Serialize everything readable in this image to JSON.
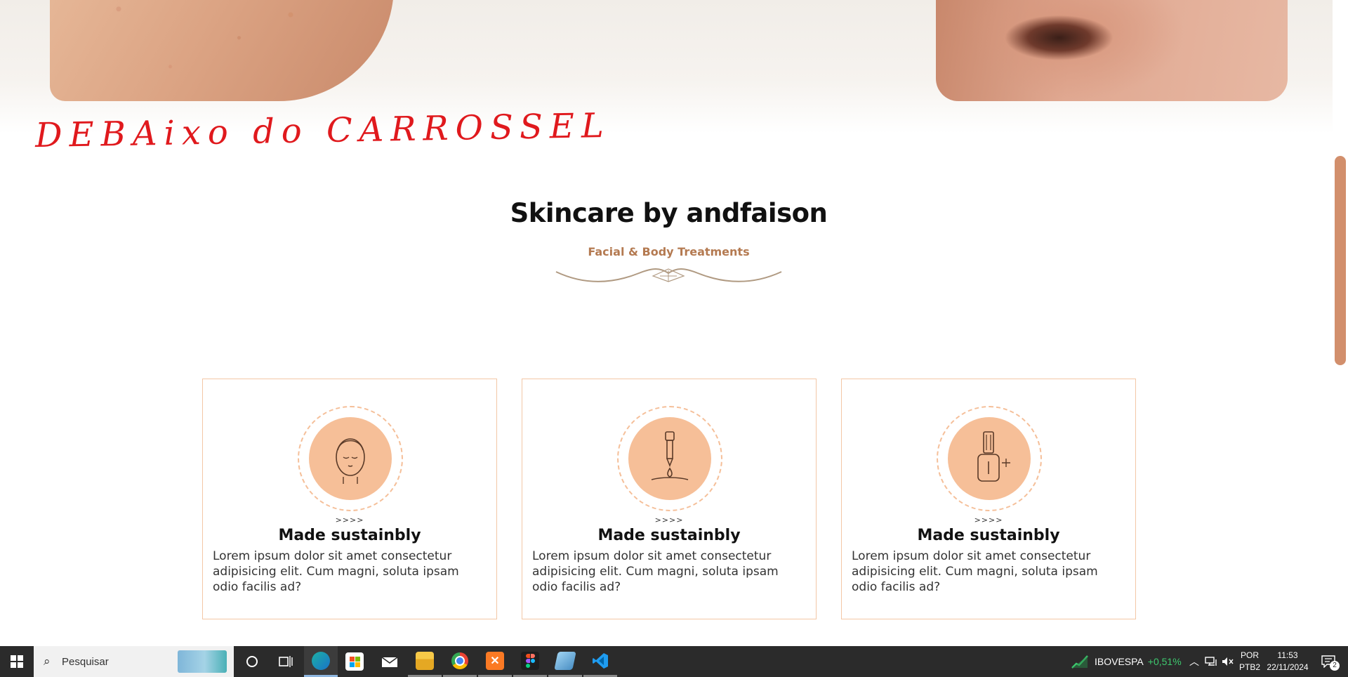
{
  "annotation": {
    "note": "DEBAixo do CARROSSEL"
  },
  "section": {
    "title": "Skincare by andfaison",
    "subtitle": "Facial & Body Treatments"
  },
  "cards": [
    {
      "icon": "face-icon",
      "arrows": ">>>>",
      "title": "Made sustainbly",
      "text": "Lorem ipsum dolor sit amet consectetur adipisicing elit. Cum magni, soluta ipsam odio facilis ad?"
    },
    {
      "icon": "dropper-icon",
      "arrows": ">>>>",
      "title": "Made sustainbly",
      "text": "Lorem ipsum dolor sit amet consectetur adipisicing elit. Cum magni, soluta ipsam odio facilis ad?"
    },
    {
      "icon": "serum-bottle-icon",
      "arrows": ">>>>",
      "title": "Made sustainbly",
      "text": "Lorem ipsum dolor sit amet consectetur adipisicing elit. Cum magni, soluta ipsam odio facilis ad?"
    }
  ],
  "colors": {
    "accent": "#b47a51",
    "icon_bg": "#f6bf98",
    "card_border": "#f3c7a6",
    "note": "#e0191d"
  },
  "taskbar": {
    "search_placeholder": "Pesquisar",
    "apps": [
      "cortana-icon",
      "task-view-icon",
      "edge-icon",
      "store-icon",
      "mail-icon",
      "file-explorer-icon",
      "chrome-icon",
      "xampp-icon",
      "figma-icon",
      "notepad-icon",
      "vscode-icon"
    ],
    "stock": {
      "name": "IBOVESPA",
      "change": "+0,51%"
    },
    "language": {
      "line1": "POR",
      "line2": "PTB2"
    },
    "clock": {
      "time": "11:53",
      "date": "22/11/2024"
    },
    "notifications": "2"
  }
}
